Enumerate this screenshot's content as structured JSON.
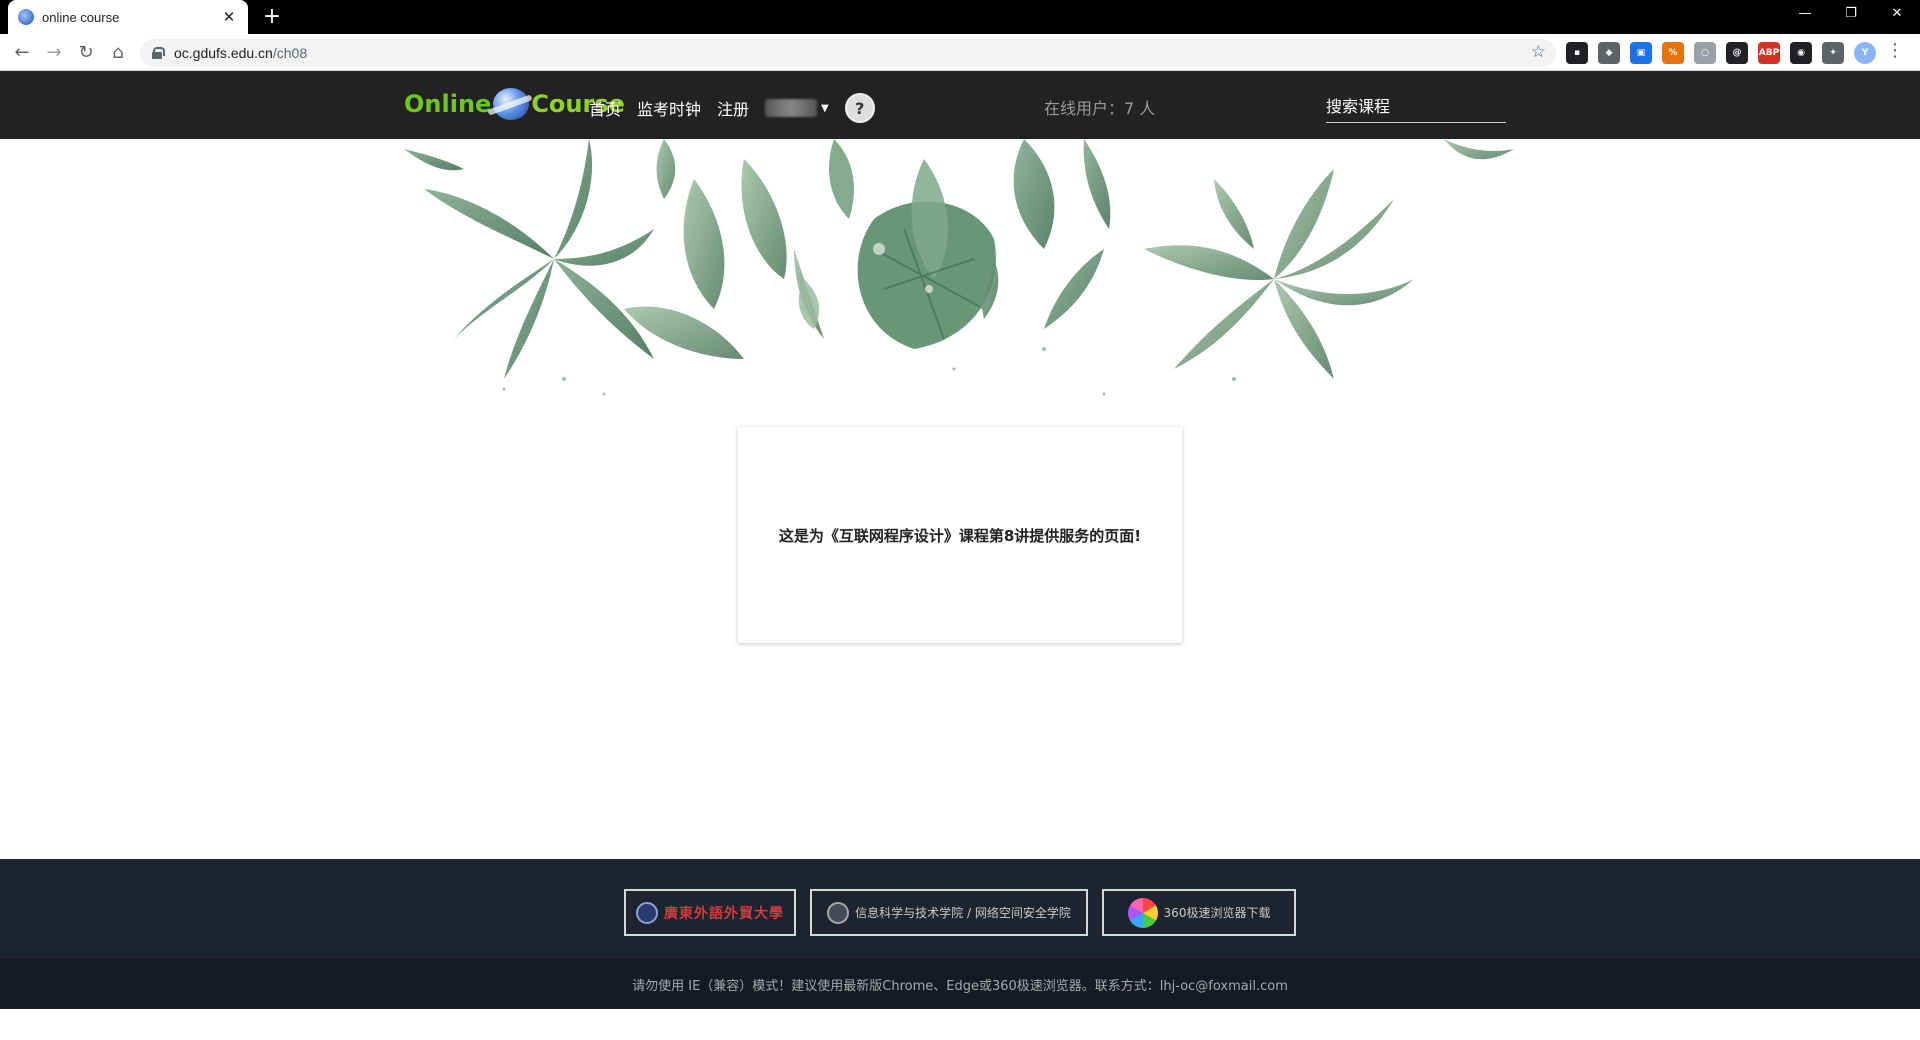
{
  "browser": {
    "tab_title": "online course",
    "tab_close": "✕",
    "new_tab": "+",
    "url_host": "oc.gdufs.edu.cn",
    "url_path": "/ch08",
    "extensions": [
      {
        "name": "ext-1",
        "color": "#202124",
        "label": "▪"
      },
      {
        "name": "ext-2",
        "color": "#5f6368",
        "label": "◆"
      },
      {
        "name": "ext-3",
        "color": "#1a73e8",
        "label": "▣"
      },
      {
        "name": "ext-4",
        "color": "#e8710a",
        "label": "%"
      },
      {
        "name": "ext-5",
        "color": "#9aa0a6",
        "label": "○"
      },
      {
        "name": "ext-6",
        "color": "#202124",
        "label": "@"
      },
      {
        "name": "ext-7",
        "color": "#d93025",
        "label": "ABP"
      },
      {
        "name": "ext-8",
        "color": "#202124",
        "label": "◉"
      },
      {
        "name": "ext-9",
        "color": "#5f6368",
        "label": "✦"
      },
      {
        "name": "profile",
        "color": "#8ab4f8",
        "label": "Y"
      }
    ]
  },
  "header": {
    "logo_left": "Online",
    "logo_right": "Course",
    "nav": {
      "home": "首页",
      "exam_clock": "监考时钟",
      "register": "注册"
    },
    "online_users": "在线用户：7 人",
    "search_course": "搜索课程"
  },
  "card": {
    "message": "这是为《互联网程序设计》课程第8讲提供服务的页面!"
  },
  "footer": {
    "link1_text": "廣東外語外貿大學",
    "link2_text": "信息科学与技术学院 / 网络空间安全学院",
    "link3_text": "360极速浏览器下载",
    "note": "请勿使用 IE（兼容）模式！建议使用最新版Chrome、Edge或360极速浏览器。联系方式：lhj-oc@foxmail.com"
  },
  "colors": {
    "header_bg": "#222222",
    "logo_green": "#6cc81f",
    "footer_top": "#1e2330",
    "footer_bottom": "#151a24"
  }
}
